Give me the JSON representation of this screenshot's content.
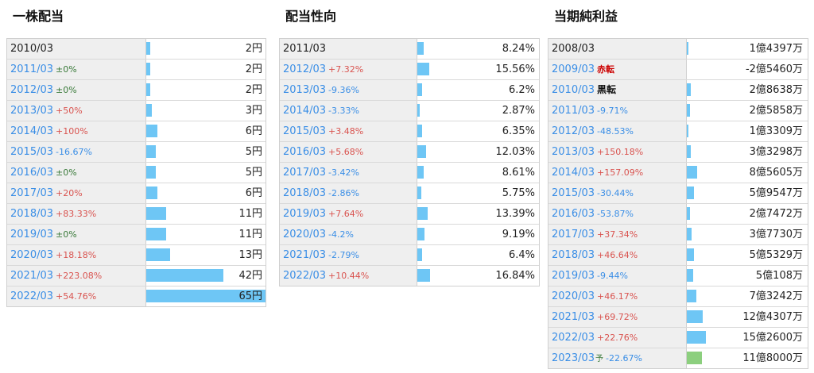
{
  "chart_data": [
    {
      "type": "table",
      "title": "一株配当",
      "rows": [
        {
          "label": "2010/03",
          "change": "",
          "value": 2,
          "display": "2円"
        },
        {
          "label": "2011/03",
          "change": "±0%",
          "value": 2,
          "display": "2円"
        },
        {
          "label": "2012/03",
          "change": "±0%",
          "value": 2,
          "display": "2円"
        },
        {
          "label": "2013/03",
          "change": "+50%",
          "value": 3,
          "display": "3円"
        },
        {
          "label": "2014/03",
          "change": "+100%",
          "value": 6,
          "display": "6円"
        },
        {
          "label": "2015/03",
          "change": "-16.67%",
          "value": 5,
          "display": "5円"
        },
        {
          "label": "2016/03",
          "change": "±0%",
          "value": 5,
          "display": "5円"
        },
        {
          "label": "2017/03",
          "change": "+20%",
          "value": 6,
          "display": "6円"
        },
        {
          "label": "2018/03",
          "change": "+83.33%",
          "value": 11,
          "display": "11円"
        },
        {
          "label": "2019/03",
          "change": "±0%",
          "value": 11,
          "display": "11円"
        },
        {
          "label": "2020/03",
          "change": "+18.18%",
          "value": 13,
          "display": "13円"
        },
        {
          "label": "2021/03",
          "change": "+223.08%",
          "value": 42,
          "display": "42円"
        },
        {
          "label": "2022/03",
          "change": "+54.76%",
          "value": 65,
          "display": "65円"
        }
      ]
    },
    {
      "type": "table",
      "title": "配当性向",
      "rows": [
        {
          "label": "2011/03",
          "change": "",
          "value": 8.24,
          "display": "8.24%"
        },
        {
          "label": "2012/03",
          "change": "+7.32%",
          "value": 15.56,
          "display": "15.56%"
        },
        {
          "label": "2013/03",
          "change": "-9.36%",
          "value": 6.2,
          "display": "6.2%"
        },
        {
          "label": "2014/03",
          "change": "-3.33%",
          "value": 2.87,
          "display": "2.87%"
        },
        {
          "label": "2015/03",
          "change": "+3.48%",
          "value": 6.35,
          "display": "6.35%"
        },
        {
          "label": "2016/03",
          "change": "+5.68%",
          "value": 12.03,
          "display": "12.03%"
        },
        {
          "label": "2017/03",
          "change": "-3.42%",
          "value": 8.61,
          "display": "8.61%"
        },
        {
          "label": "2018/03",
          "change": "-2.86%",
          "value": 5.75,
          "display": "5.75%"
        },
        {
          "label": "2019/03",
          "change": "+7.64%",
          "value": 13.39,
          "display": "13.39%"
        },
        {
          "label": "2020/03",
          "change": "-4.2%",
          "value": 9.19,
          "display": "9.19%"
        },
        {
          "label": "2021/03",
          "change": "-2.79%",
          "value": 6.4,
          "display": "6.4%"
        },
        {
          "label": "2022/03",
          "change": "+10.44%",
          "value": 16.84,
          "display": "16.84%"
        }
      ]
    },
    {
      "type": "table",
      "title": "当期純利益",
      "rows": [
        {
          "label": "2008/03",
          "change": "",
          "tag": "",
          "value": 143970000,
          "display": "1億4397万"
        },
        {
          "label": "2009/03",
          "change": "",
          "tag": "赤転",
          "value": -254600000,
          "display": "-2億5460万"
        },
        {
          "label": "2010/03",
          "change": "",
          "tag": "黒転",
          "value": 286380000,
          "display": "2億8638万"
        },
        {
          "label": "2011/03",
          "change": "-9.71%",
          "tag": "",
          "value": 258580000,
          "display": "2億5858万"
        },
        {
          "label": "2012/03",
          "change": "-48.53%",
          "tag": "",
          "value": 133090000,
          "display": "1億3309万"
        },
        {
          "label": "2013/03",
          "change": "+150.18%",
          "tag": "",
          "value": 332980000,
          "display": "3億3298万"
        },
        {
          "label": "2014/03",
          "change": "+157.09%",
          "tag": "",
          "value": 856050000,
          "display": "8億5605万"
        },
        {
          "label": "2015/03",
          "change": "-30.44%",
          "tag": "",
          "value": 595470000,
          "display": "5億9547万"
        },
        {
          "label": "2016/03",
          "change": "-53.87%",
          "tag": "",
          "value": 274720000,
          "display": "2億7472万"
        },
        {
          "label": "2017/03",
          "change": "+37.34%",
          "tag": "",
          "value": 377300000,
          "display": "3億7730万"
        },
        {
          "label": "2018/03",
          "change": "+46.64%",
          "tag": "",
          "value": 553290000,
          "display": "5億5329万"
        },
        {
          "label": "2019/03",
          "change": "-9.44%",
          "tag": "",
          "value": 501080000,
          "display": "5億108万"
        },
        {
          "label": "2020/03",
          "change": "+46.17%",
          "tag": "",
          "value": 732420000,
          "display": "7億3242万"
        },
        {
          "label": "2021/03",
          "change": "+69.72%",
          "tag": "",
          "value": 1243070000,
          "display": "12億4307万"
        },
        {
          "label": "2022/03",
          "change": "+22.76%",
          "tag": "",
          "value": 1526000000,
          "display": "15億2600万"
        },
        {
          "label": "2023/03",
          "change": "-22.67%",
          "tag": "予",
          "value": 1180000000,
          "display": "11億8000万",
          "forecast": true
        }
      ]
    }
  ],
  "colors": {
    "bar": "#6ec6f5",
    "forecast_bar": "#8ccf7e",
    "up": "#d9534f",
    "down": "#3a8ee6",
    "flat": "#3a7a3a",
    "label_bg": "#efefef"
  }
}
